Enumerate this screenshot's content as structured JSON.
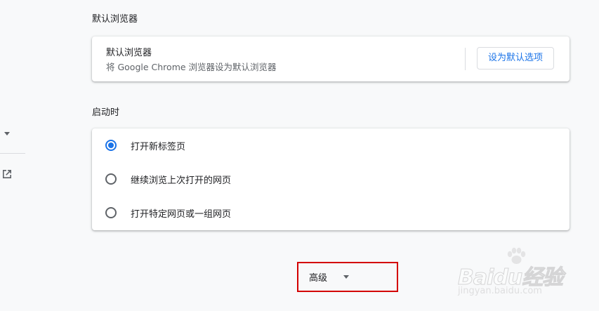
{
  "default_browser_section": {
    "heading": "默认浏览器",
    "card_title": "默认浏览器",
    "card_description": "将 Google Chrome 浏览器设为默认浏览器",
    "make_default_button": "设为默认选项"
  },
  "startup_section": {
    "heading": "启动时",
    "options": [
      {
        "label": "打开新标签页",
        "checked": true
      },
      {
        "label": "继续浏览上次打开的网页",
        "checked": false
      },
      {
        "label": "打开特定网页或一组网页",
        "checked": false
      }
    ]
  },
  "advanced": {
    "label": "高级"
  },
  "watermark": {
    "brand": "Baidu经验",
    "url": "jingyan.baidu.com"
  },
  "icons": {
    "left_dropdown": "arrow-drop-down-icon",
    "left_external": "open-in-new-icon",
    "advanced_arrow": "arrow-drop-down-icon"
  },
  "colors": {
    "accent": "#1a73e8",
    "highlight_box": "#d30000",
    "background": "#f8f9fa"
  }
}
